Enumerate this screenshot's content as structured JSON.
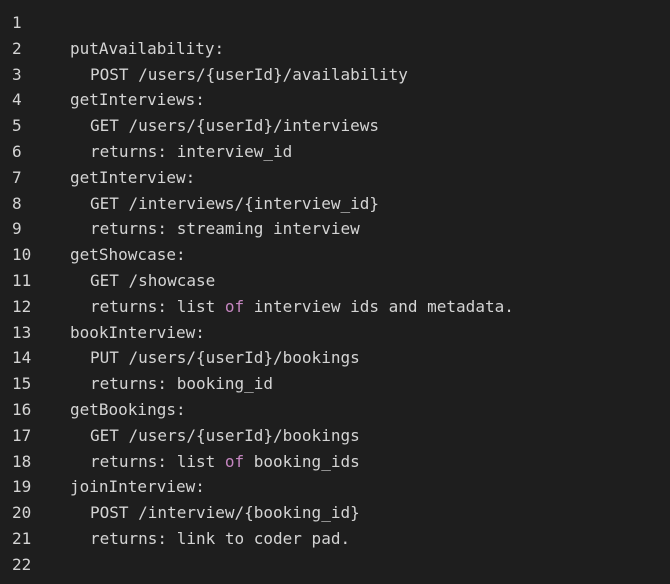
{
  "editor": {
    "lines": [
      {
        "number": "1",
        "indent": 0,
        "segments": []
      },
      {
        "number": "2",
        "indent": 0,
        "segments": [
          {
            "text": "putAvailability:",
            "kind": "plain"
          }
        ]
      },
      {
        "number": "3",
        "indent": 1,
        "segments": [
          {
            "text": "POST /users/{userId}/availability",
            "kind": "plain"
          }
        ]
      },
      {
        "number": "4",
        "indent": 0,
        "segments": [
          {
            "text": "getInterviews:",
            "kind": "plain"
          }
        ]
      },
      {
        "number": "5",
        "indent": 1,
        "segments": [
          {
            "text": "GET /users/{userId}/interviews",
            "kind": "plain"
          }
        ]
      },
      {
        "number": "6",
        "indent": 1,
        "segments": [
          {
            "text": "returns: interview_id",
            "kind": "plain"
          }
        ]
      },
      {
        "number": "7",
        "indent": 0,
        "segments": [
          {
            "text": "getInterview:",
            "kind": "plain"
          }
        ]
      },
      {
        "number": "8",
        "indent": 1,
        "segments": [
          {
            "text": "GET /interviews/{interview_id}",
            "kind": "plain"
          }
        ]
      },
      {
        "number": "9",
        "indent": 1,
        "segments": [
          {
            "text": "returns: streaming interview",
            "kind": "plain"
          }
        ]
      },
      {
        "number": "10",
        "indent": 0,
        "segments": [
          {
            "text": "getShowcase:",
            "kind": "plain"
          }
        ]
      },
      {
        "number": "11",
        "indent": 1,
        "segments": [
          {
            "text": "GET /showcase",
            "kind": "plain"
          }
        ]
      },
      {
        "number": "12",
        "indent": 1,
        "segments": [
          {
            "text": "returns: list ",
            "kind": "plain"
          },
          {
            "text": "of",
            "kind": "keyword"
          },
          {
            "text": " interview ids and metadata.",
            "kind": "plain"
          }
        ]
      },
      {
        "number": "13",
        "indent": 0,
        "segments": [
          {
            "text": "bookInterview:",
            "kind": "plain"
          }
        ]
      },
      {
        "number": "14",
        "indent": 1,
        "segments": [
          {
            "text": "PUT /users/{userId}/bookings",
            "kind": "plain"
          }
        ]
      },
      {
        "number": "15",
        "indent": 1,
        "segments": [
          {
            "text": "returns: booking_id",
            "kind": "plain"
          }
        ]
      },
      {
        "number": "16",
        "indent": 0,
        "segments": [
          {
            "text": "getBookings:",
            "kind": "plain"
          }
        ]
      },
      {
        "number": "17",
        "indent": 1,
        "segments": [
          {
            "text": "GET /users/{userId}/bookings",
            "kind": "plain"
          }
        ]
      },
      {
        "number": "18",
        "indent": 1,
        "segments": [
          {
            "text": "returns: list ",
            "kind": "plain"
          },
          {
            "text": "of",
            "kind": "keyword"
          },
          {
            "text": " booking_ids",
            "kind": "plain"
          }
        ]
      },
      {
        "number": "19",
        "indent": 0,
        "segments": [
          {
            "text": "joinInterview:",
            "kind": "plain"
          }
        ]
      },
      {
        "number": "20",
        "indent": 1,
        "segments": [
          {
            "text": "POST /interview/{booking_id}",
            "kind": "plain"
          }
        ]
      },
      {
        "number": "21",
        "indent": 1,
        "segments": [
          {
            "text": "returns: link to coder pad.",
            "kind": "plain"
          }
        ]
      },
      {
        "number": "22",
        "indent": 0,
        "segments": []
      }
    ]
  },
  "colors": {
    "background": "#1e1e1e",
    "text": "#d4d4d4",
    "keyword": "#c586c0",
    "line_number": "#d4d4d4"
  }
}
